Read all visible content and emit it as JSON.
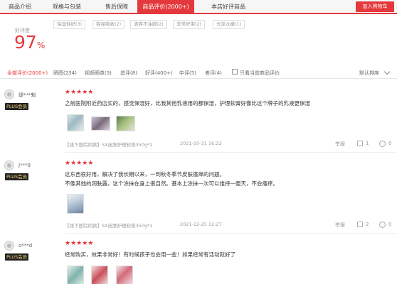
{
  "tabs": [
    {
      "label": "商品介绍"
    },
    {
      "label": "规格与包装"
    },
    {
      "label": "售后保障"
    },
    {
      "label": "商品评价(2000+)"
    },
    {
      "label": "本店好评商品"
    }
  ],
  "cart_label": "加入购物车",
  "rating": {
    "label": "好评度",
    "value": "97",
    "unit": "%"
  },
  "tags": [
    "保湿性好(3)",
    "容易吸收(2)",
    "清爽不油腻(2)",
    "非常好用(2)",
    "光泽水嫩(1)"
  ],
  "filters": [
    {
      "label": "全部评价(2000+)"
    },
    {
      "label": "晒图(234)"
    },
    {
      "label": "视频晒单(3)"
    },
    {
      "label": "追评(8)"
    },
    {
      "label": "好评(400+)"
    },
    {
      "label": "中评(5)"
    },
    {
      "label": "差评(4)"
    }
  ],
  "only_current_label": "只看当前商品评价",
  "sort_label": "默认排序",
  "stars_text": "★★★★★",
  "reviews": [
    {
      "user": "缇***魁",
      "badge": "PLUS会员",
      "lines": [
        "之前医院附近药店买的，感觉保湿好，比我其他乳液用的都保湿，护理软膏好像比这个牌子的乳液更保湿"
      ],
      "product": "【线下医院同款】SX皮肤护理软膏350g*1",
      "date": "2021-10-31 16:22",
      "report": "举报",
      "likes": "1",
      "comments": "0"
    },
    {
      "user": "J***8",
      "badge": "PLUS会员",
      "lines": [
        "这东西很好用，解决了我长期以来，一到秋冬季节皮肤瘙痒的问题。",
        "不像其他的润肤露，这个涂抹在身上很自然。基本上涂抹一次可以维持一整天，不会瘙痒。"
      ],
      "product": "【线下医院同款】SX皮肤护理软膏350g*1",
      "date": "2021-12-25 12:27",
      "report": "举报",
      "likes": "2",
      "comments": "0"
    },
    {
      "user": "o***d",
      "badge": "PLUS会员",
      "lines": [
        "经常购买，效果非常好！有时候孩子也会用一些！如果经常有活动就好了"
      ]
    }
  ]
}
